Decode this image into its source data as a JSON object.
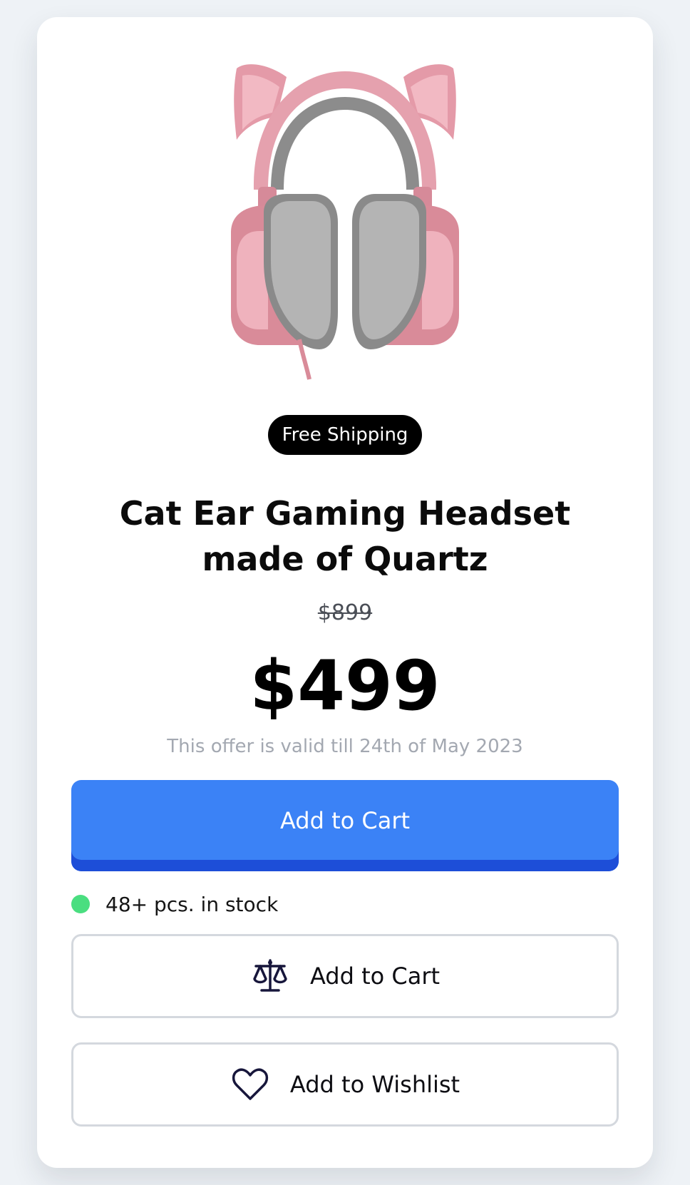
{
  "product": {
    "image_alt": "Cat ear gaming headset",
    "badge": "Free Shipping",
    "title": "Cat Ear Gaming Headset made of Quartz",
    "old_price": "$899",
    "price": "$499",
    "offer_note": "This offer is valid till 24th of May 2023"
  },
  "actions": {
    "primary_cart_label": "Add to Cart",
    "compare_label": "Add to Cart",
    "compare_icon": "scale-icon",
    "wishlist_label": "Add to Wishlist",
    "wishlist_icon": "heart-icon"
  },
  "stock": {
    "label": "48+ pcs. in stock",
    "status_color": "#4ade80"
  },
  "colors": {
    "primary": "#3b82f6",
    "primary_dark": "#1d4ed8",
    "badge_bg": "#000000"
  }
}
